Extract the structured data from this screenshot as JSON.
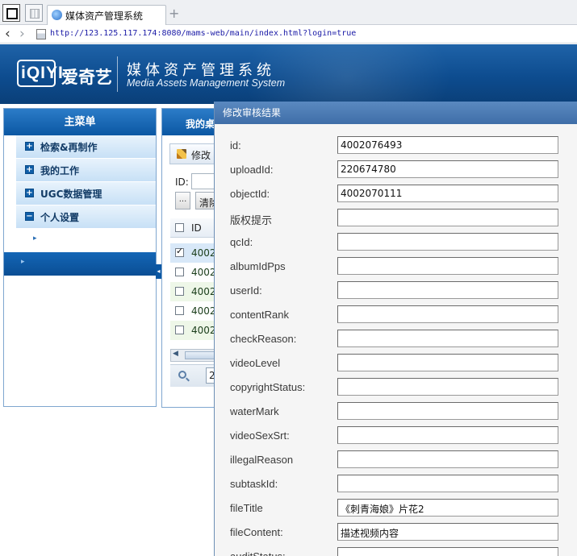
{
  "browser": {
    "tab_title": "媒体资产管理系统",
    "new_tab": "+",
    "url": "http://123.125.117.174:8080/mams-web/main/index.html?login=true"
  },
  "header": {
    "logo_text": "iQIYI",
    "logo_cn": "爱奇艺",
    "system_cn": "媒体资产管理系统",
    "system_en": "Media Assets Management System"
  },
  "sidebar": {
    "title": "主菜单",
    "items": [
      {
        "label": "检索&再制作",
        "icon": "+"
      },
      {
        "label": "我的工作",
        "icon": "+"
      },
      {
        "label": "UGC数据管理",
        "icon": "+"
      },
      {
        "label": "个人设置",
        "icon": "−"
      }
    ]
  },
  "center": {
    "title": "我的桌",
    "edit_label": "修改",
    "id_label": "ID:",
    "dots_label": "...",
    "clear_label": "清除",
    "grid_header_id": "ID",
    "rows": [
      "4002",
      "4002",
      "4002",
      "4002",
      "4002"
    ],
    "page_value": "2"
  },
  "dialog": {
    "title": "修改审核结果",
    "fields": [
      {
        "label": "id:",
        "value": "4002076493"
      },
      {
        "label": "uploadId:",
        "value": "220674780"
      },
      {
        "label": "objectId:",
        "value": "4002070111"
      },
      {
        "label": "版权提示",
        "value": ""
      },
      {
        "label": "qcId:",
        "value": ""
      },
      {
        "label": "albumIdPps",
        "value": ""
      },
      {
        "label": "userId:",
        "value": ""
      },
      {
        "label": "contentRank",
        "value": ""
      },
      {
        "label": "checkReason:",
        "value": ""
      },
      {
        "label": "videoLevel",
        "value": ""
      },
      {
        "label": "copyrightStatus:",
        "value": ""
      },
      {
        "label": "waterMark",
        "value": ""
      },
      {
        "label": "videoSexSrt:",
        "value": ""
      },
      {
        "label": "illegalReason",
        "value": ""
      },
      {
        "label": "subtaskId:",
        "value": ""
      },
      {
        "label": "fileTitle",
        "value": "《刺青海娘》片花2"
      },
      {
        "label": "fileContent:",
        "value": "描述视频内容"
      },
      {
        "label": "auditStatus:",
        "value": ""
      }
    ]
  },
  "colors": {
    "header_blue": "#0d4c8f",
    "menu_blue": "#0b57a3",
    "dialog_header": "#4f7db5"
  }
}
